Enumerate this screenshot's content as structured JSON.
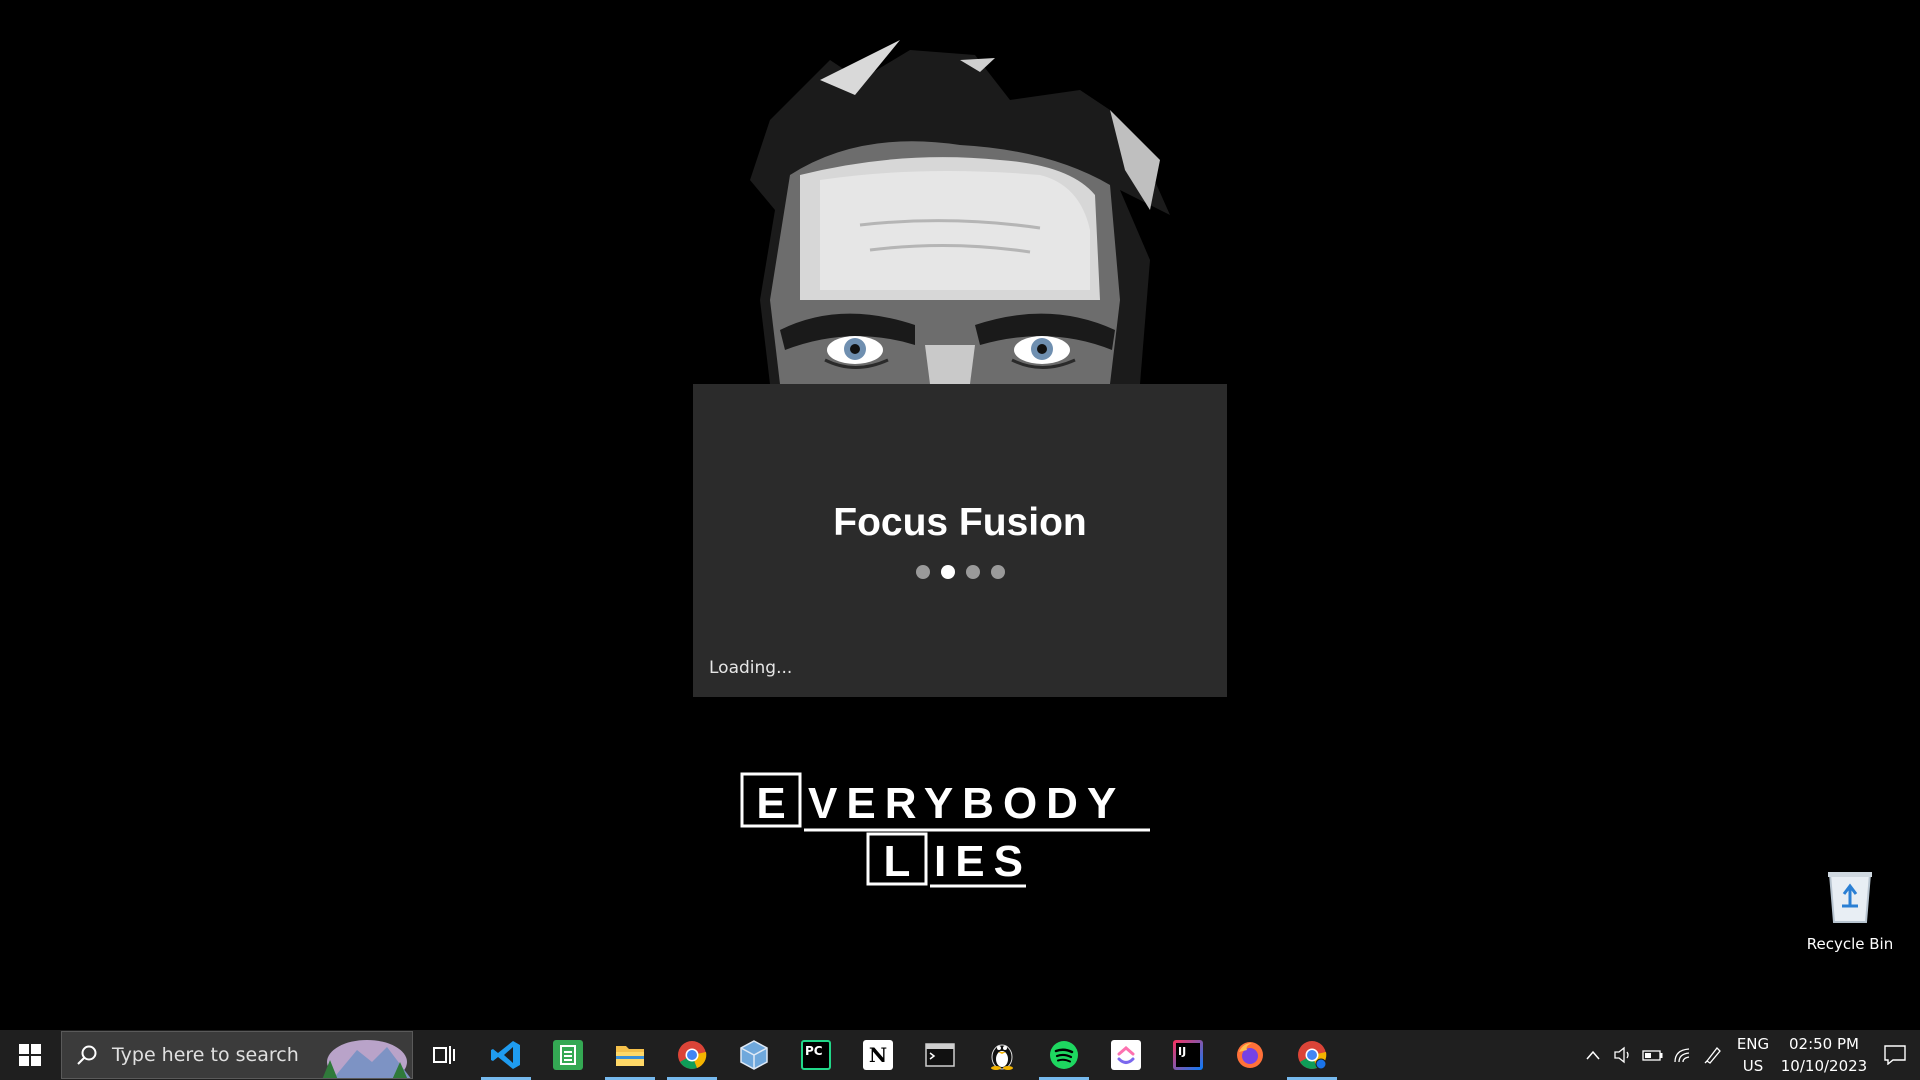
{
  "splash": {
    "title": "Focus Fusion",
    "status": "Loading...",
    "dots_total": 4,
    "dots_active_index": 1
  },
  "wallpaper": {
    "logo_lines": [
      "EVERYBODY",
      "LIES"
    ]
  },
  "desktop": {
    "recycle_bin_label": "Recycle Bin"
  },
  "taskbar": {
    "search_placeholder": "Type here to search",
    "apps": [
      {
        "name": "Visual Studio Code",
        "icon": "vscode-icon",
        "running": true
      },
      {
        "name": "Sheets",
        "icon": "spreadsheet-icon",
        "running": false
      },
      {
        "name": "File Explorer",
        "icon": "folder-icon",
        "running": true
      },
      {
        "name": "Google Chrome",
        "icon": "chrome-icon",
        "running": true
      },
      {
        "name": "VirtualBox",
        "icon": "box-icon",
        "running": false
      },
      {
        "name": "PyCharm",
        "icon": "pycharm-icon",
        "running": false
      },
      {
        "name": "Notion",
        "icon": "notion-icon",
        "running": false
      },
      {
        "name": "Terminal",
        "icon": "terminal-icon",
        "running": false
      },
      {
        "name": "Linux",
        "icon": "tux-icon",
        "running": false
      },
      {
        "name": "Spotify",
        "icon": "spotify-icon",
        "running": true
      },
      {
        "name": "ClickUp",
        "icon": "clickup-icon",
        "running": false
      },
      {
        "name": "IntelliJ IDEA",
        "icon": "intellij-icon",
        "running": false
      },
      {
        "name": "Firefox",
        "icon": "firefox-icon",
        "running": false
      },
      {
        "name": "Google Chrome Profile",
        "icon": "chrome-profile-icon",
        "running": true
      }
    ],
    "tray": {
      "lang_line1": "ENG",
      "lang_line2": "US",
      "time": "02:50 PM",
      "date": "10/10/2023"
    }
  },
  "colors": {
    "splash_bg": "#2b2b2b",
    "taskbar_bg": "#1f1f1f",
    "running_indicator": "#76b9ed"
  }
}
